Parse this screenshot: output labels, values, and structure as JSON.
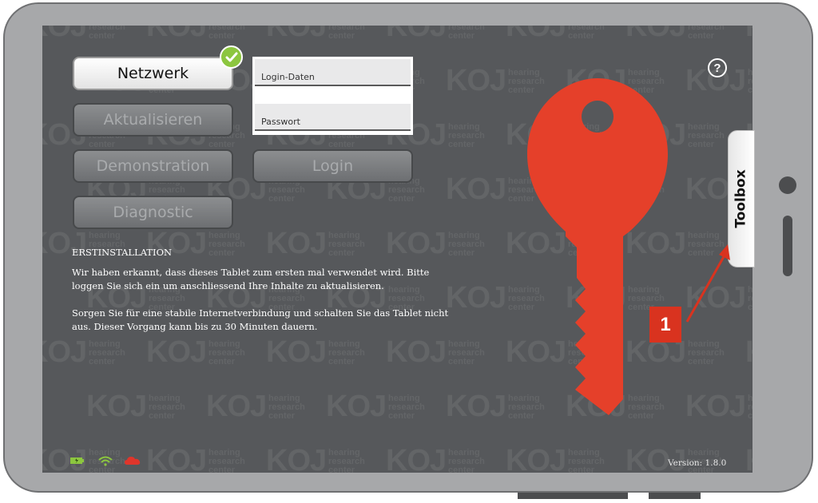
{
  "nav": {
    "network_label": "Netzwerk",
    "update_label": "Aktualisieren",
    "demo_label": "Demonstration",
    "diagnostic_label": "Diagnostic"
  },
  "login": {
    "username_placeholder": "Login-Daten",
    "password_placeholder": "Passwort",
    "button_label": "Login"
  },
  "info": {
    "heading": "ERSTINSTALLATION",
    "paragraph1": "Wir haben erkannt, dass dieses Tablet zum ersten mal verwendet wird. Bitte loggen Sie sich ein um anschliessend Ihre Inhalte zu aktualisieren.",
    "paragraph2": "Sorgen Sie für eine stabile Internetverbindung und schalten Sie das Tablet nicht aus. Dieser Vorgang kann bis zu 30 Minuten dauern."
  },
  "toolbox": {
    "label": "Toolbox"
  },
  "help": {
    "symbol": "?"
  },
  "annotation": {
    "badge": "1"
  },
  "version": "Version: 1.8.0",
  "watermark": {
    "logo": "KOJ",
    "tagline": [
      "hearing",
      "research",
      "center"
    ]
  },
  "status_icons": [
    "battery-icon",
    "wifi-icon",
    "cloud-icon"
  ],
  "colors": {
    "screen_bg": "#56585b",
    "key": "#e5402a",
    "accent_green": "#8cc63f",
    "badge_red": "#d9331f",
    "device_frame": "#a7a8aa"
  }
}
